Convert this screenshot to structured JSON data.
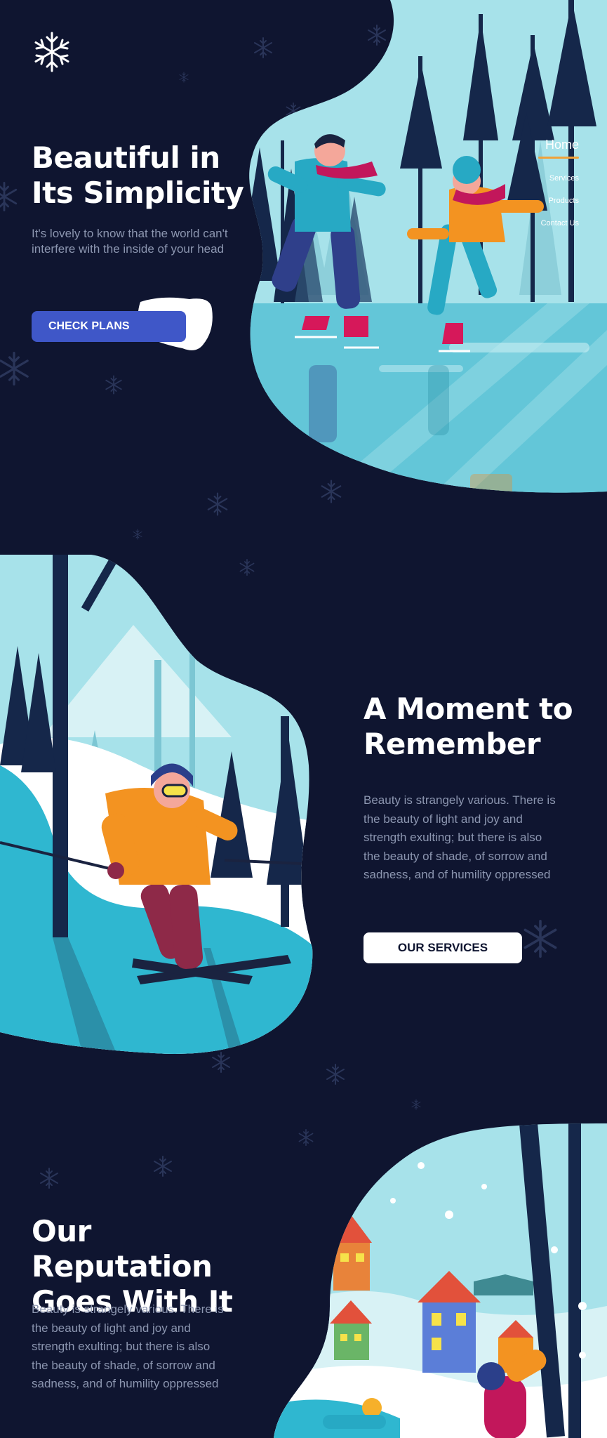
{
  "colors": {
    "background": "#0f1530",
    "accent_underline": "#f0a23a",
    "primary_button": "#3f57c8",
    "muted_text": "#8c96b0",
    "ice_blue": "#a7e2ea",
    "teal": "#2fb7d0"
  },
  "logo": {
    "icon": "snowflake-icon"
  },
  "nav": {
    "home": "Home",
    "items": [
      "Services",
      "Products",
      "Contact Us"
    ]
  },
  "hero": {
    "title_line1": "Beautiful in",
    "title_line2": "Its Simplicity",
    "subtitle": "It's lovely to know that the world can't interfere with the inside of your head",
    "cta": "CHECK PLANS"
  },
  "moment": {
    "title_line1": "A Moment to",
    "title_line2": "Remember",
    "text": "Beauty is strangely various. There is the beauty of light and joy and strength exulting; but there is also the beauty of shade, of sorrow and sadness, and of humility oppressed",
    "cta": "OUR SERVICES"
  },
  "reputation": {
    "title_line1": "Our Reputation",
    "title_line2": "Goes With It",
    "text": "Beauty is strangely various. There is the beauty of light and joy and strength exulting; but there is also the beauty of shade, of sorrow and sadness, and of humility oppressed"
  }
}
